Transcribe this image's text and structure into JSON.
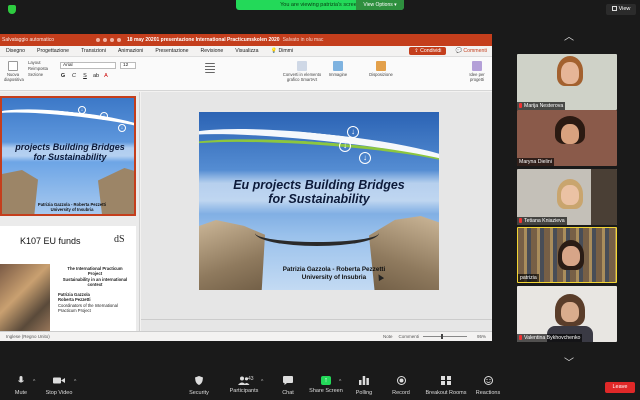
{
  "zoom": {
    "banner_text": "You are viewing patrizia's screen",
    "view_options_label": "View Options",
    "view_button_label": "View",
    "leave_label": "Leave",
    "toolbar": [
      {
        "key": "mute",
        "label": "Mute",
        "icon": "microphone-icon"
      },
      {
        "key": "video",
        "label": "Stop Video",
        "icon": "video-camera-icon"
      },
      {
        "key": "security",
        "label": "Security",
        "icon": "shield-icon"
      },
      {
        "key": "participants",
        "label": "Participants",
        "icon": "participants-icon",
        "count": "43"
      },
      {
        "key": "chat",
        "label": "Chat",
        "icon": "chat-icon"
      },
      {
        "key": "share",
        "label": "Share Screen",
        "icon": "share-screen-icon"
      },
      {
        "key": "polling",
        "label": "Polling",
        "icon": "polling-icon"
      },
      {
        "key": "record",
        "label": "Record",
        "icon": "record-icon"
      },
      {
        "key": "breakout",
        "label": "Breakout Rooms",
        "icon": "breakout-rooms-icon"
      },
      {
        "key": "reactions",
        "label": "Reactions",
        "icon": "reactions-icon"
      }
    ],
    "participants": [
      {
        "name": "Marija Nesterova"
      },
      {
        "name": "Maryna Dielini"
      },
      {
        "name": "Tetiana Kniazieva"
      },
      {
        "name": "patrizia"
      },
      {
        "name": "Valentina Bykhovchenko"
      }
    ],
    "share_color": "#23d959",
    "leave_color": "#e02828"
  },
  "ppt": {
    "left_title": "Salvataggio automatico",
    "doc_title": "18 may 20201 presentazione International Practicumskolen 2020",
    "saved_status": "Salvato in olu mac",
    "tabs": [
      "Diseg",
      "Disegno",
      "Progettazione",
      "Transizioni",
      "Animazioni",
      "Presentazione",
      "Revisione",
      "Visualizza",
      "Dimmi"
    ],
    "comments_label": "Commenti",
    "share_label": "Condividi",
    "font_name": "Arial",
    "font_size": "12",
    "ribbon_labels": {
      "new_slide": "Nuova diapositiva",
      "layout": "Layout",
      "reset": "Reimposta",
      "section": "Sezione",
      "image": "Immagine",
      "layout2": "Disposizione",
      "designer": "Idee per progetti",
      "convert": "Converti in elemento grafico SmartArt"
    },
    "accent_color": "#c43e1c",
    "slide": {
      "title_line1": "Eu projects Building Bridges",
      "title_line2": "for Sustainability",
      "authors_line1": "Patrizia Gazzola - Roberta Pezzetti",
      "authors_line2": "University of Insubria"
    },
    "thumb1": {
      "title_line1": "projects Building Bridges",
      "title_line2": "for Sustainability",
      "authors_line1": "Patrizia Gazzola - Roberta Pezzetti",
      "authors_line2": "University of Insubria"
    },
    "thumb2": {
      "heading": "K107 EU funds",
      "logo": "dS",
      "line1": "The International Practicum",
      "line2": "Project",
      "line3": "Sustainability in an international",
      "line4": "context",
      "name1": "Patrizia Gazzola",
      "name2": "Roberta Pezzetti",
      "name3": "Coordinators of the International",
      "name4": "Practicum Project"
    },
    "status": {
      "language": "Inglese (Regno Unito)",
      "notes": "Note",
      "comments": "Commenti",
      "zoom": "95%"
    }
  }
}
